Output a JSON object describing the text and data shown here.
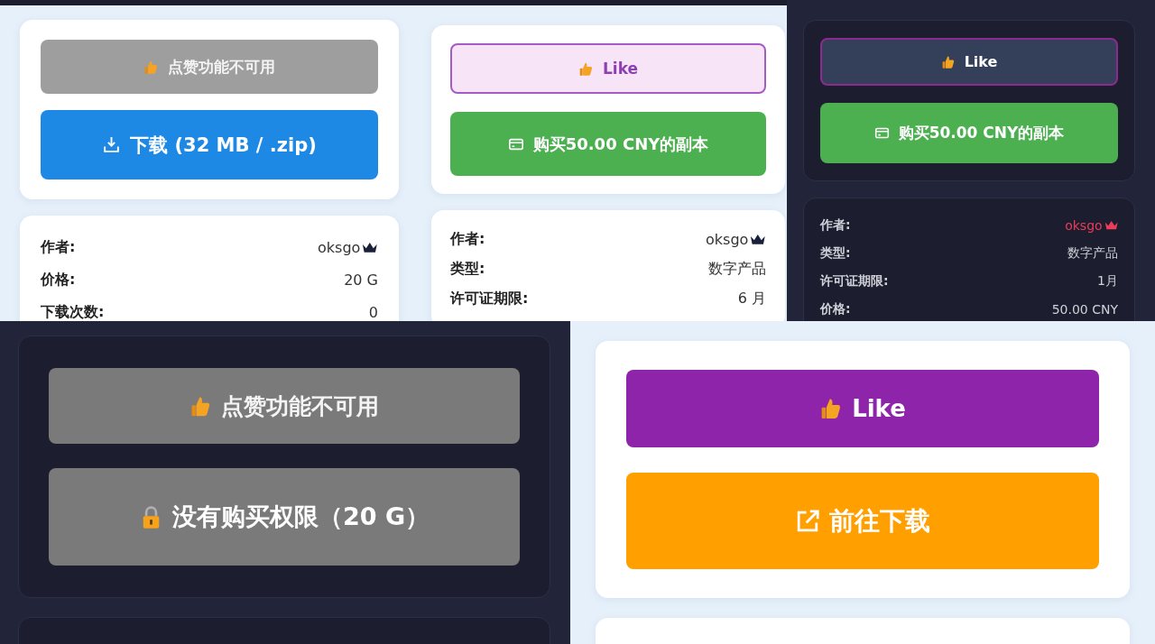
{
  "panels": [
    {
      "dark": false,
      "actions": [
        {
          "kind": "like-disabled",
          "label": "点赞功能不可用"
        },
        {
          "kind": "download",
          "label": "下载 (32 MB / .zip)"
        }
      ],
      "info": [
        {
          "kind": "author",
          "label": "作者:",
          "value": "oksgo"
        },
        {
          "kind": "plain",
          "label": "价格:",
          "value": "20 G"
        },
        {
          "kind": "plain",
          "label": "下载次数:",
          "value": "0"
        }
      ]
    },
    {
      "dark": false,
      "actions": [
        {
          "kind": "like-outline",
          "label": "Like"
        },
        {
          "kind": "buy",
          "label": "购买50.00 CNY的副本"
        }
      ],
      "info": [
        {
          "kind": "author",
          "label": "作者:",
          "value": "oksgo"
        },
        {
          "kind": "plain",
          "label": "类型:",
          "value": "数字产品"
        },
        {
          "kind": "plain",
          "label": "许可证期限:",
          "value": "6 月"
        }
      ]
    },
    {
      "dark": true,
      "actions": [
        {
          "kind": "like-dark",
          "label": "Like"
        },
        {
          "kind": "buy",
          "label": "购买50.00 CNY的副本"
        }
      ],
      "info": [
        {
          "kind": "author",
          "label": "作者:",
          "value": "oksgo"
        },
        {
          "kind": "plain",
          "label": "类型:",
          "value": "数字产品"
        },
        {
          "kind": "plain",
          "label": "许可证期限:",
          "value": "1月"
        },
        {
          "kind": "plain",
          "label": "价格:",
          "value": "50.00 CNY"
        }
      ]
    },
    {
      "dark": true,
      "actions": [
        {
          "kind": "like-disabled",
          "label": "点赞功能不可用"
        },
        {
          "kind": "locked",
          "label": "没有购买权限（20 G）"
        }
      ]
    },
    {
      "dark": false,
      "actions": [
        {
          "kind": "like-filled",
          "label": "Like"
        },
        {
          "kind": "external",
          "label": "前往下载"
        }
      ]
    }
  ]
}
